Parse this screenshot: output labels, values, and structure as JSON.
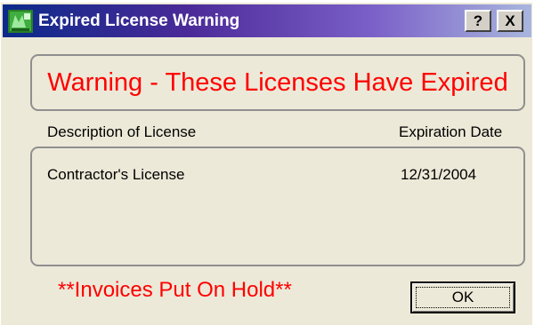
{
  "window": {
    "title": "Expired License Warning",
    "help_label": "?",
    "close_label": "X",
    "app_icon": "sage-app-icon"
  },
  "warning": {
    "text": "Warning - These Licenses Have Expired",
    "color": "#ff0000"
  },
  "table": {
    "columns": [
      "Description of License",
      "Expiration Date"
    ],
    "rows": [
      {
        "description": "Contractor's License",
        "expiration": "12/31/2004"
      }
    ]
  },
  "footer": {
    "hold_text": "**Invoices Put On Hold**",
    "ok_label": "OK"
  }
}
